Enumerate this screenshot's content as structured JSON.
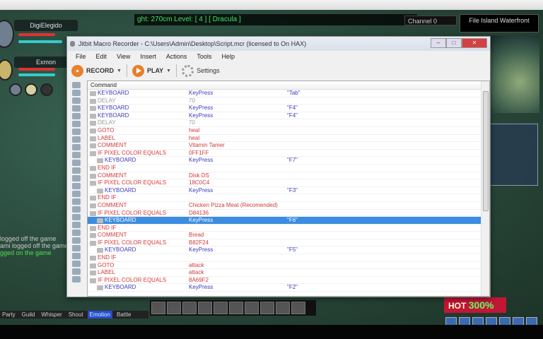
{
  "game": {
    "party": [
      {
        "name": "DigiElegido"
      },
      {
        "name": "Exmon"
      }
    ],
    "info_bar": "ght: 270cm Level: [ 4 ] [ Dracula ]",
    "channel": "Channel 0",
    "area": "File Island Waterfront",
    "chat_lines": [
      {
        "text": "logged off the game",
        "color": "#c8c8c8"
      },
      {
        "text": "ami logged off the game",
        "color": "#c8c8c8"
      },
      {
        "text": "gged on the game",
        "color": "#4ce04c"
      }
    ],
    "chat_tabs": [
      "Party",
      "Guild",
      "Whisper",
      "Shout",
      "Emotion",
      "Battle"
    ],
    "active_chat_tab": "Emotion",
    "hot_label": "HOT",
    "hot_value": "300%"
  },
  "window": {
    "title": "Jitbit Macro Recorder - C:\\Users\\Admin\\Desktop\\Script.mcr (licensed to On HAX)",
    "menu": [
      "File",
      "Edit",
      "View",
      "Insert",
      "Actions",
      "Tools",
      "Help"
    ],
    "toolbar": {
      "record": "RECORD",
      "play": "PLAY",
      "settings": "Settings"
    },
    "column_header": "Command",
    "rows": [
      {
        "cmd": "KEYBOARD",
        "arg": "KeyPress",
        "val": "\"Tab\"",
        "style": "blue"
      },
      {
        "cmd": "DELAY",
        "arg": "70",
        "val": "",
        "style": "gray"
      },
      {
        "cmd": "KEYBOARD",
        "arg": "KeyPress",
        "val": "\"F4\"",
        "style": "blue"
      },
      {
        "cmd": "KEYBOARD",
        "arg": "KeyPress",
        "val": "\"F4\"",
        "style": "blue"
      },
      {
        "cmd": "DELAY",
        "arg": "70",
        "val": "",
        "style": "gray"
      },
      {
        "cmd": "GOTO",
        "arg": "heal",
        "val": "",
        "style": "red"
      },
      {
        "cmd": "LABEL",
        "arg": "heal",
        "val": "",
        "style": "red"
      },
      {
        "cmd": "COMMENT",
        "arg": "Vitamin Tamer",
        "val": "",
        "style": "red"
      },
      {
        "cmd": "IF PIXEL COLOR EQUALS",
        "arg": "0FF1FF",
        "val": "",
        "style": "red"
      },
      {
        "cmd": "KEYBOARD",
        "arg": "KeyPress",
        "val": "\"F7\"",
        "style": "blue",
        "indent": true
      },
      {
        "cmd": "END IF",
        "arg": "",
        "val": "",
        "style": "red"
      },
      {
        "cmd": "COMMENT",
        "arg": "Disk DS",
        "val": "",
        "style": "red"
      },
      {
        "cmd": "IF PIXEL COLOR EQUALS",
        "arg": "18C0C4",
        "val": "",
        "style": "red"
      },
      {
        "cmd": "KEYBOARD",
        "arg": "KeyPress",
        "val": "\"F3\"",
        "style": "blue",
        "indent": true
      },
      {
        "cmd": "END IF",
        "arg": "",
        "val": "",
        "style": "red"
      },
      {
        "cmd": "COMMENT",
        "arg": "Chicken Pizza Meat (Recomended)",
        "val": "",
        "style": "red"
      },
      {
        "cmd": "IF PIXEL COLOR EQUALS",
        "arg": "D84136",
        "val": "",
        "style": "red"
      },
      {
        "cmd": "KEYBOARD",
        "arg": "KeyPress",
        "val": "\"F6\"",
        "style": "blue",
        "indent": true,
        "selected": true
      },
      {
        "cmd": "END IF",
        "arg": "",
        "val": "",
        "style": "red"
      },
      {
        "cmd": "COMMENT",
        "arg": "Bread",
        "val": "",
        "style": "red"
      },
      {
        "cmd": "IF PIXEL COLOR EQUALS",
        "arg": "B82F24",
        "val": "",
        "style": "red"
      },
      {
        "cmd": "KEYBOARD",
        "arg": "KeyPress",
        "val": "\"F5\"",
        "style": "blue",
        "indent": true
      },
      {
        "cmd": "END IF",
        "arg": "",
        "val": "",
        "style": "red"
      },
      {
        "cmd": "GOTO",
        "arg": "attack",
        "val": "",
        "style": "red"
      },
      {
        "cmd": "LABEL",
        "arg": "attack",
        "val": "",
        "style": "red"
      },
      {
        "cmd": "IF PIXEL COLOR EQUALS",
        "arg": "8A69F2",
        "val": "",
        "style": "red"
      },
      {
        "cmd": "KEYBOARD",
        "arg": "KeyPress",
        "val": "\"F2\"",
        "style": "blue",
        "indent": true
      }
    ]
  }
}
